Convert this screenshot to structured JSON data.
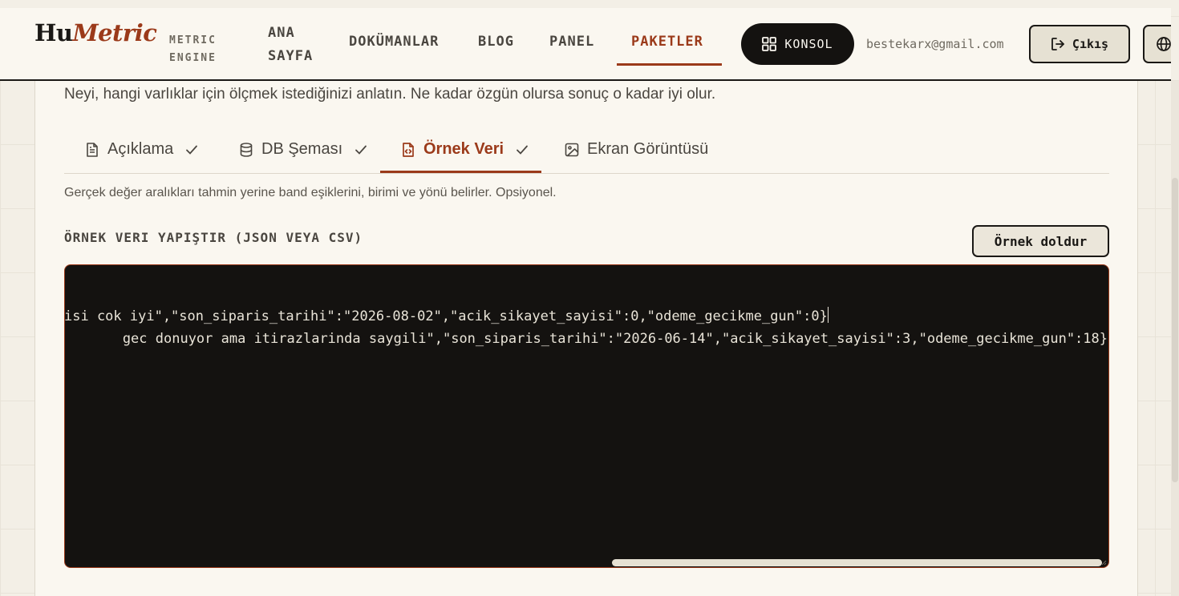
{
  "header": {
    "logo_hu": "Hu",
    "logo_metric": "Metric",
    "logo_sub_line1": "METRIC",
    "logo_sub_line2": "ENGINE",
    "nav": {
      "ana_sayfa_line1": "ANA",
      "ana_sayfa_line2": "SAYFA",
      "dokumanlar": "DOKÜMANLAR",
      "blog": "BLOG",
      "panel": "PANEL",
      "paketler": "PAKETLER"
    },
    "active_nav": "PAKETLER",
    "konsol_label": "KONSOL",
    "email": "bestekarx@gmail.com",
    "logout_label": "Çıkış"
  },
  "card": {
    "intro": "Neyi, hangi varlıklar için ölçmek istediğinizi anlatın. Ne kadar özgün olursa sonuç o kadar iyi olur.",
    "tabs": [
      {
        "label": "Açıklama",
        "icon": "file-text-icon",
        "checked": true
      },
      {
        "label": "DB Şeması",
        "icon": "database-icon",
        "checked": true
      },
      {
        "label": "Örnek Veri",
        "icon": "file-code-icon",
        "checked": true,
        "active": true
      },
      {
        "label": "Ekran Görüntüsü",
        "icon": "image-icon",
        "checked": false
      }
    ],
    "hint": "Gerçek değer aralıkları tahmin yerine band eşiklerini, birimi ve yönü belirler. Opsiyonel.",
    "section_label": "ÖRNEK VERI YAPIŞTIR (JSON VEYA CSV)",
    "fill_button": "Örnek doldur",
    "editor": {
      "line1": "gec donuyor ama itirazlarinda saygili\",\"son_siparis_tarihi\":\"2026-06-14\",\"acik_sikayet_sayisi\":3,\"odeme_gecikme_gun\":18}",
      "line2": "isi cok iyi\",\"son_siparis_tarihi\":\"2026-08-02\",\"acik_sikayet_sayisi\":0,\"odeme_gecikme_gun\":0}"
    }
  },
  "colors": {
    "accent": "#9b3a1a",
    "background": "#f3efe6",
    "surface": "#faf7f0",
    "editor_bg": "#141210",
    "text_dark": "#1a1815"
  }
}
